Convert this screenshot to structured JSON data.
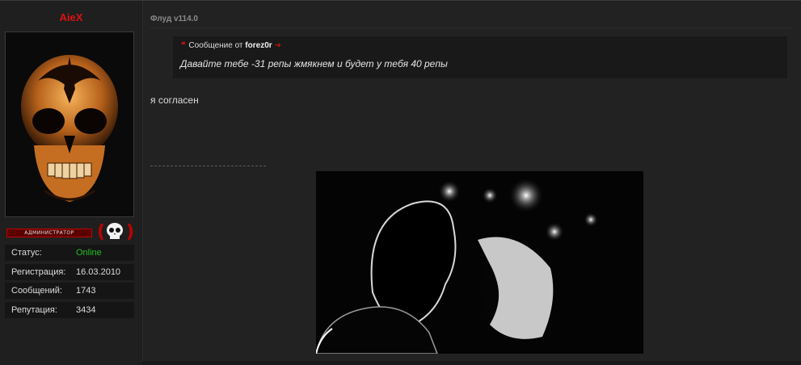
{
  "user": {
    "name": "AieX",
    "rank_label": "АДМИНИСТРАТОР",
    "stats": [
      {
        "label": "Статус:",
        "value": "Online"
      },
      {
        "label": "Регистрация:",
        "value": "16.03.2010"
      },
      {
        "label": "Сообщений:",
        "value": "1743"
      },
      {
        "label": "Репутация:",
        "value": "3434"
      }
    ]
  },
  "post": {
    "title": "Флуд v114.0",
    "quote": {
      "prefix": "Сообщение от",
      "author": "forez0r",
      "text": "Давайте тебе -31 репы жмякнем и будет у тебя 40 репы"
    },
    "body": "я согласен"
  },
  "icons": {
    "quote": "quote-mark-icon",
    "goto": "goto-post-arrow-icon",
    "skull": "skull-icon"
  },
  "colors": {
    "username": "#e01010",
    "online": "#22c022",
    "accent": "#c00000"
  }
}
